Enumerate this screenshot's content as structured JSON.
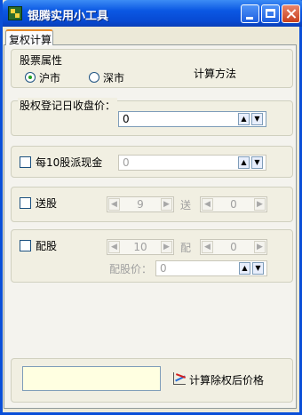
{
  "window": {
    "title": "银腾实用小工具"
  },
  "tabs": [
    {
      "label": "复权计算"
    }
  ],
  "stock_type": {
    "legend": "股票属性",
    "options": [
      {
        "label": "沪市",
        "selected": true
      },
      {
        "label": "深市",
        "selected": false
      }
    ],
    "method_label": "计算方法"
  },
  "close_price": {
    "label": "股权登记日收盘价：",
    "value": "0"
  },
  "cash_dividend": {
    "label": "每10股派现金",
    "value": "0",
    "checked": false
  },
  "bonus_shares": {
    "label": "送股",
    "left_value": "9",
    "mid_label": "送",
    "right_value": "0",
    "checked": false
  },
  "rights_issue": {
    "label": "配股",
    "left_value": "10",
    "mid_label": "配",
    "right_value": "0",
    "price_label": "配股价：",
    "price_value": "0",
    "checked": false
  },
  "result": {
    "value": "",
    "button_label": "计算除权后价格"
  },
  "icons": {
    "app": "app-icon",
    "minimize": "minimize-icon",
    "maximize": "maximize-icon",
    "close": "close-icon",
    "spin_up": "▲",
    "spin_down": "▼",
    "arrow_left": "◀",
    "arrow_right": "▶",
    "chart": "chart-icon"
  },
  "colors": {
    "titlebar": "#0b58e3",
    "tab_highlight": "#e68b2c",
    "result_background": "#ffffe1"
  }
}
